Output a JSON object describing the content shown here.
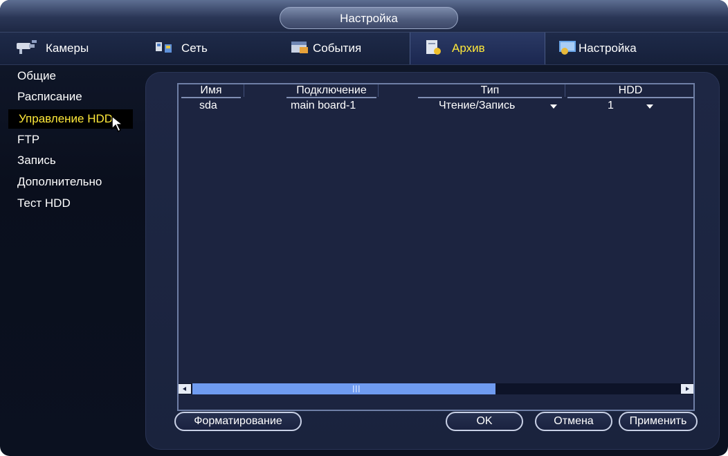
{
  "window": {
    "title": "Настройка"
  },
  "tabs": [
    {
      "label": "Камеры",
      "icon": "camera-icon"
    },
    {
      "label": "Сеть",
      "icon": "network-icon"
    },
    {
      "label": "События",
      "icon": "events-icon"
    },
    {
      "label": "Архив",
      "icon": "storage-icon",
      "active": true
    },
    {
      "label": "Настройка",
      "icon": "settings-icon"
    }
  ],
  "sidebar": {
    "items": [
      {
        "label": "Общие"
      },
      {
        "label": "Расписание"
      },
      {
        "label": "Управление HDD",
        "active": true
      },
      {
        "label": "FTP"
      },
      {
        "label": "Запись"
      },
      {
        "label": "Дополнительно"
      },
      {
        "label": "Тест HDD"
      }
    ]
  },
  "table": {
    "columns": [
      "Имя",
      "Подключение",
      "Тип",
      "HDD"
    ],
    "rows": [
      {
        "name": "sda",
        "connection": "main board-1",
        "type": "Чтение/Запись",
        "hdd": "1"
      }
    ]
  },
  "scrollbar": {
    "position": 0.0,
    "visible_fraction": 0.59
  },
  "buttons": {
    "format": "Форматирование",
    "ok": "OK",
    "cancel": "Отмена",
    "apply": "Применить"
  },
  "colors": {
    "accent_text": "#ffe93a",
    "scroll_thumb": "#6f9bf0",
    "panel_bg": "#1e2744"
  }
}
